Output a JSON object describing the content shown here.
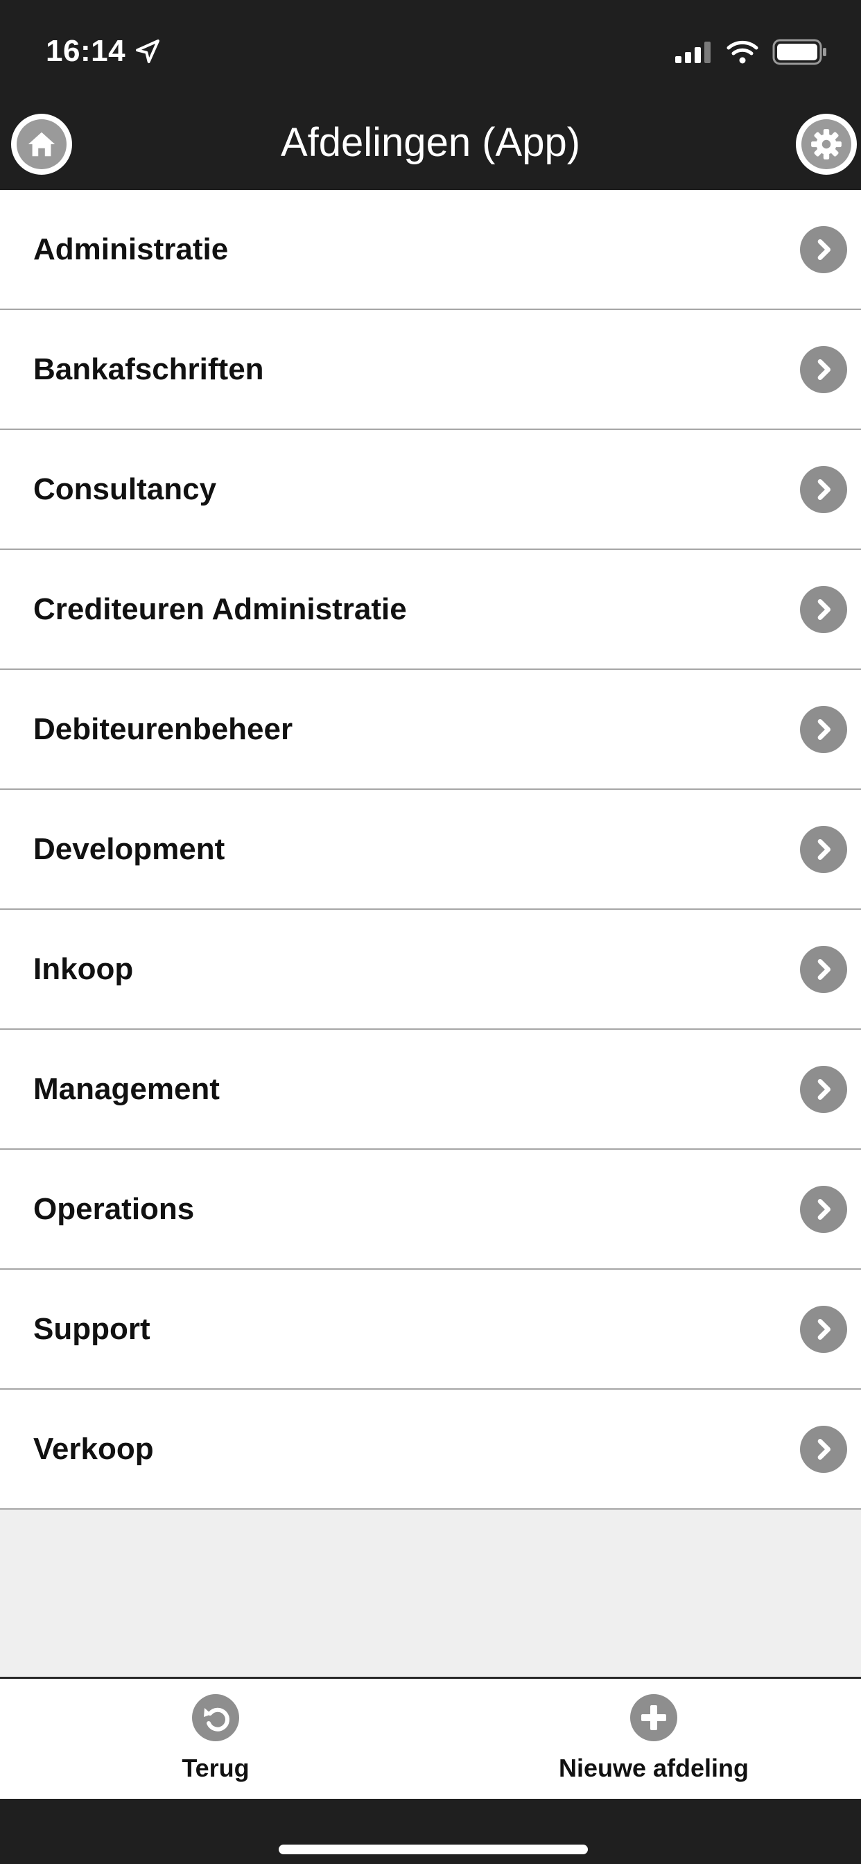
{
  "status_bar": {
    "time": "16:14",
    "location_icon": "location-arrow-icon",
    "signal_icon": "cellular-signal-icon",
    "wifi_icon": "wifi-icon",
    "battery_icon": "battery-icon"
  },
  "header": {
    "title": "Afdelingen (App)",
    "home_icon": "home-icon",
    "settings_icon": "gear-icon",
    "background": "#1f1f1f"
  },
  "departments": [
    "Administratie",
    "Bankafschriften",
    "Consultancy",
    "Crediteuren Administratie",
    "Debiteurenbeheer",
    "Development",
    "Inkoop",
    "Management",
    "Operations",
    "Support",
    "Verkoop"
  ],
  "list_chevron_icon": "chevron-right-icon",
  "toolbar": {
    "back_label": "Terug",
    "back_icon": "undo-icon",
    "new_label": "Nieuwe afdeling",
    "new_icon": "plus-icon"
  }
}
